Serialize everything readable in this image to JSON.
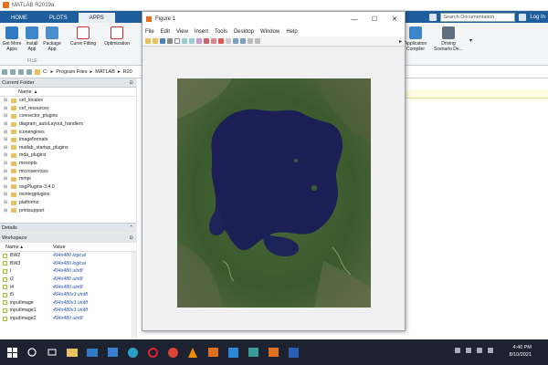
{
  "app": {
    "title": "MATLAB R2019a"
  },
  "tabs": [
    "HOME",
    "PLOTS",
    "APPS"
  ],
  "search": {
    "placeholder": "Search Documentation"
  },
  "login_label": "Log In",
  "ribbon": {
    "file_section_label": "FILE",
    "buttons": [
      {
        "label": "Get More Apps",
        "icon": "get-more-apps-icon"
      },
      {
        "label": "Install App",
        "icon": "install-app-icon"
      },
      {
        "label": "Package App",
        "icon": "package-app-icon"
      },
      {
        "label": "Curve Fitting",
        "icon": "curve-fitting-icon"
      },
      {
        "label": "Optimization",
        "icon": "optimization-icon"
      },
      {
        "label": "Application Compiler",
        "icon": "application-compiler-icon"
      },
      {
        "label": "Driving Scenario De...",
        "icon": "driving-scenario-icon"
      }
    ]
  },
  "address_path": [
    "C:",
    "Program Files",
    "MATLAB",
    "R20"
  ],
  "current_folder": {
    "header": "Current Folder",
    "column_name": "Name",
    "items": [
      "cef_locales",
      "cef_resources",
      "connector_plugins",
      "diagram_autoLayout_handlers",
      "iconengines",
      "imageformats",
      "matlab_startup_plugins",
      "mda_plugins",
      "mexopts",
      "microservices",
      "mmpi",
      "osgPlugins-3.4.0",
      "osintegplugins",
      "platforms",
      "printsupport"
    ]
  },
  "details_label": "Details",
  "workspace": {
    "header": "Workspace",
    "col_name": "Name",
    "col_value": "Value",
    "rows": [
      {
        "name": "BW2",
        "value": "494x480 logical"
      },
      {
        "name": "BW3",
        "value": "494x480 logical"
      },
      {
        "name": "i",
        "value": "494x480 uint8"
      },
      {
        "name": "i2",
        "value": "494x480 uint8"
      },
      {
        "name": "i4",
        "value": "494x480 uint8"
      },
      {
        "name": "i5",
        "value": "494x480x3 uint8"
      },
      {
        "name": "inputImage",
        "value": "494x480x3 uint8"
      },
      {
        "name": "inputImage1",
        "value": "494x480x3 uint8"
      },
      {
        "name": "inputImage2",
        "value": "494x480 uint8"
      }
    ]
  },
  "figure": {
    "title": "Figure 1",
    "menu": [
      "File",
      "Edit",
      "View",
      "Insert",
      "Tools",
      "Desktop",
      "Window",
      "Help"
    ]
  },
  "clock": {
    "time": "4:40 PM",
    "date": "8/10/2021"
  },
  "colors": {
    "tabbar": "#1f5e9c",
    "taskbar": "#1c2230",
    "lake": "#1b1f55",
    "land": "#3d5a2c"
  }
}
